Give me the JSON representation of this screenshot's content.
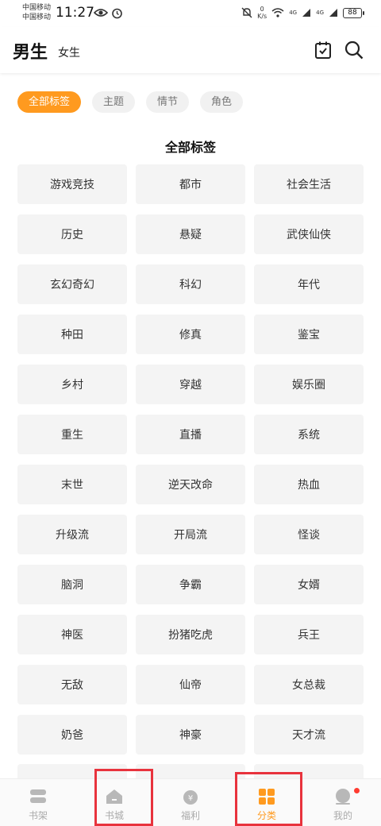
{
  "status_bar": {
    "carrier_1": "中国移动",
    "carrier_2": "中国移动",
    "time": "11:27",
    "net_speed_value": "0",
    "net_speed_unit": "K/s",
    "signal_1_tag": "4G",
    "signal_2_tag": "4G",
    "battery": "88"
  },
  "header": {
    "tab_male": "男生",
    "tab_female": "女生",
    "accent_color": "#ff9a1f"
  },
  "filters": [
    {
      "label": "全部标签",
      "active": true
    },
    {
      "label": "主题",
      "active": false
    },
    {
      "label": "情节",
      "active": false
    },
    {
      "label": "角色",
      "active": false
    }
  ],
  "section_title": "全部标签",
  "tags": [
    "游戏竞技",
    "都市",
    "社会生活",
    "历史",
    "悬疑",
    "武侠仙侠",
    "玄幻奇幻",
    "科幻",
    "年代",
    "种田",
    "修真",
    "鉴宝",
    "乡村",
    "穿越",
    "娱乐圈",
    "重生",
    "直播",
    "系统",
    "末世",
    "逆天改命",
    "热血",
    "升级流",
    "开局流",
    "怪谈",
    "脑洞",
    "争霸",
    "女婿",
    "神医",
    "扮猪吃虎",
    "兵王",
    "无敌",
    "仙帝",
    "女总裁",
    "奶爸",
    "神豪",
    "天才流"
  ],
  "bottom_nav": [
    {
      "label": "书架",
      "icon": "bookshelf-icon"
    },
    {
      "label": "书城",
      "icon": "bookstore-icon"
    },
    {
      "label": "福利",
      "icon": "welfare-icon"
    },
    {
      "label": "分类",
      "icon": "category-icon",
      "active": true
    },
    {
      "label": "我的",
      "icon": "profile-icon"
    }
  ],
  "highlight_color": "#e8333d"
}
